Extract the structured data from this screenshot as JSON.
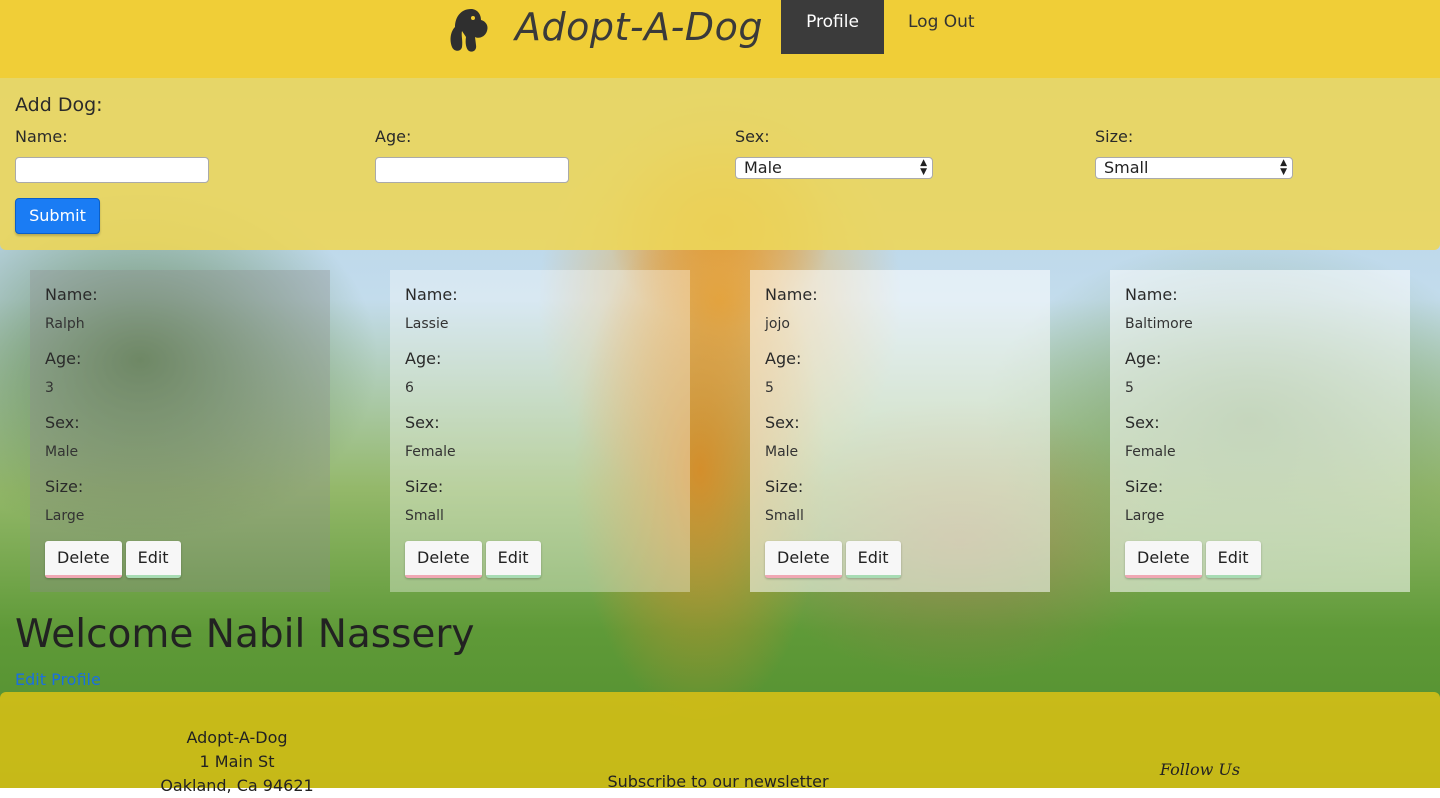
{
  "header": {
    "logo_icon": "dog-head-icon",
    "brand": "Adopt-A-Dog",
    "nav": {
      "profile": "Profile",
      "logout": "Log Out"
    }
  },
  "add_dog": {
    "title": "Add Dog:",
    "name_label": "Name:",
    "age_label": "Age:",
    "sex_label": "Sex:",
    "size_label": "Size:",
    "name_value": "",
    "age_value": "",
    "sex_selected": "Male",
    "size_selected": "Small",
    "submit": "Submit"
  },
  "card_labels": {
    "name": "Name:",
    "age": "Age:",
    "sex": "Sex:",
    "size": "Size:"
  },
  "dogs": [
    {
      "name": "Ralph",
      "age": "3",
      "sex": "Male",
      "size": "Large"
    },
    {
      "name": "Lassie",
      "age": "6",
      "sex": "Female",
      "size": "Small"
    },
    {
      "name": "jojo",
      "age": "5",
      "sex": "Male",
      "size": "Small"
    },
    {
      "name": "Baltimore",
      "age": "5",
      "sex": "Female",
      "size": "Large"
    }
  ],
  "card_buttons": {
    "delete": "Delete",
    "edit": "Edit"
  },
  "welcome": "Welcome Nabil Nassery",
  "edit_profile": "Edit Profile",
  "footer": {
    "address_line1": "Adopt-A-Dog",
    "address_line2": "1 Main St",
    "address_line3": "Oakland, Ca 94621",
    "subscribe": "Subscribe to our newsletter",
    "follow": "Follow Us"
  },
  "colors": {
    "header_bg": "#f3ce30",
    "nav_active_bg": "#3b3b3b",
    "submit_bg": "#1a7cf4",
    "link": "#1a6fe0"
  }
}
